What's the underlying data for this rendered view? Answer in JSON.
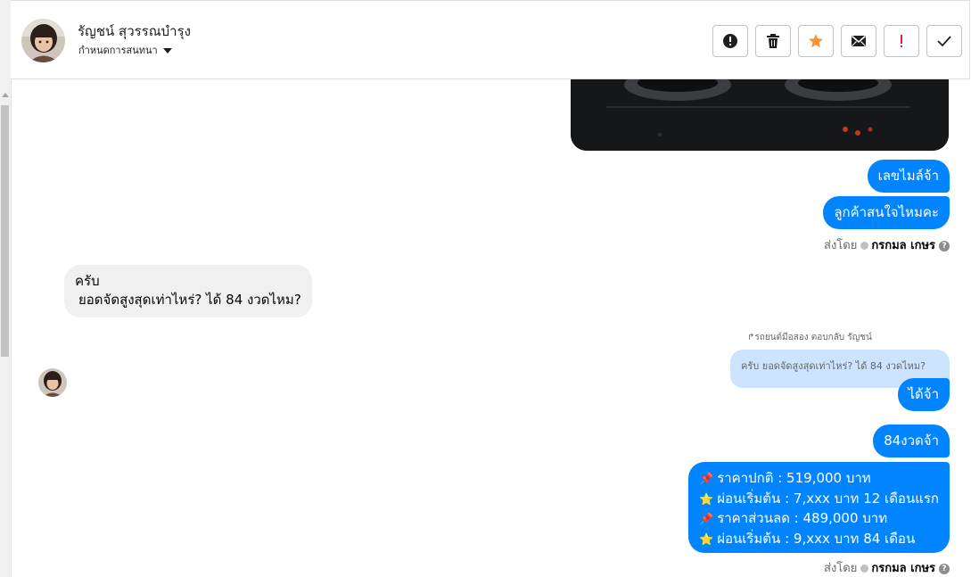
{
  "header": {
    "contact_name": "รัญชน์ สุวรรณบำรุง",
    "conversation_label": "กำหนดการสนทนา",
    "toolbar": [
      "spam-icon",
      "trash-icon",
      "star-icon",
      "mail-icon",
      "exclamation-icon",
      "check-icon"
    ]
  },
  "colors": {
    "accent": "#0084ff",
    "star": "#f7923b",
    "exclaim": "#e41e3f",
    "quote_bg": "#cce4ff"
  },
  "messages": {
    "out1": "เลขไมล์จ้า",
    "out2": "ลูกค้าสนใจไหมคะ",
    "sent_by_label": "ส่งโดย",
    "sender": "กรกมล เกษร",
    "in_line1": "ครับ",
    "in_line2": "ยอดจัดสูงสุดเท่าไหร่? ได้ 84 งวดไหม?",
    "reply_label": "รถยนต์มือสอง ตอบกลับ รัญชน์",
    "reply_quote": "ครับ ยอดจัดสูงสุดเท่าไหร่? ได้ 84 งวดไหม?",
    "out3": "ได้จ้า",
    "out4": "84งวดจ้า",
    "price_lines": [
      "ราคาปกติ : 519,000 บาท",
      "ผ่อนเริ่มต้น : 7,xxx บาท 12 เดือนแรก",
      "ราคาส่วนลด : 489,000 บาท",
      "ผ่อนเริ่มต้น : 9,xxx บาท 84 เดือน"
    ],
    "price_emojis": [
      "📌",
      "⭐",
      "📌",
      "⭐"
    ]
  }
}
